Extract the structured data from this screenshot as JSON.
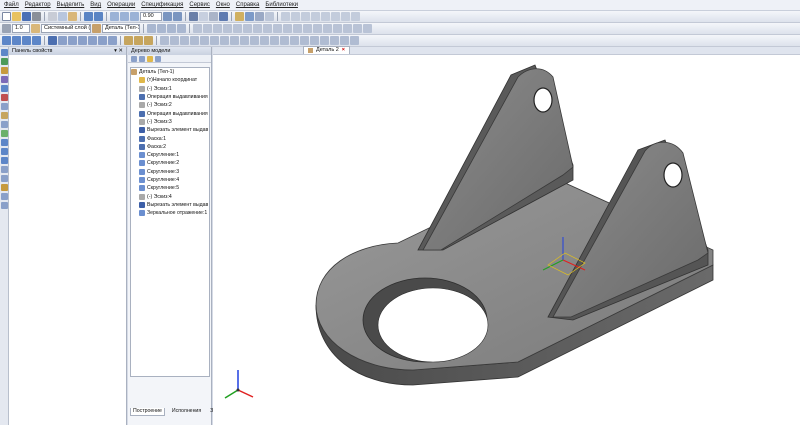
{
  "menu": [
    "Файл",
    "Редактор",
    "Выделить",
    "Вид",
    "Операции",
    "Спецификация",
    "Сервис",
    "Окно",
    "Справка",
    "Библиотеки"
  ],
  "toolbar": {
    "zoom_value": "0.90",
    "scale_value": "1.0",
    "coord_system": "Системный слой (0)",
    "detail_selector": "Деталь (Тел-1)"
  },
  "properties_panel": {
    "title": "Панель свойств",
    "pin": "▾ ✕"
  },
  "tree_panel": {
    "title": "Дерево модели",
    "root": "Деталь (Тел-1)",
    "items": [
      "(т)Начало координат",
      "(-) Эскиз:1",
      "Операция выдавливания",
      "(-) Эскиз:2",
      "Операция выдавливания",
      "(-) Эскиз:3",
      "Вырезать элемент выдав",
      "Фаска:1",
      "Фаска:2",
      "Скругление:1",
      "Скругление:2",
      "Скругление:3",
      "Скругление:4",
      "Скругление:5",
      "(-) Эскиз:4",
      "Вырезать элемент выдав",
      "Зеркальное отражение:1"
    ],
    "tabs": [
      "Построение",
      "Исполнения",
      "Зоны"
    ]
  },
  "document_tab": {
    "label": "Деталь 2",
    "close": "×"
  },
  "colors": {
    "part_face_top": "#8d8d8d",
    "part_face_side": "#565656",
    "part_face_dark": "#3e3e3e",
    "background": "#ffffff",
    "axis_x": "#e02020",
    "axis_y": "#20a020",
    "axis_z": "#2040e0"
  },
  "icons": [
    "new-icon",
    "open-icon",
    "save-icon",
    "print-icon",
    "cut-icon",
    "copy-icon",
    "paste-icon",
    "undo-icon",
    "redo-icon",
    "zoom-icon",
    "rotate-icon",
    "shaded-icon",
    "wireframe-icon",
    "axis-triad-icon"
  ]
}
